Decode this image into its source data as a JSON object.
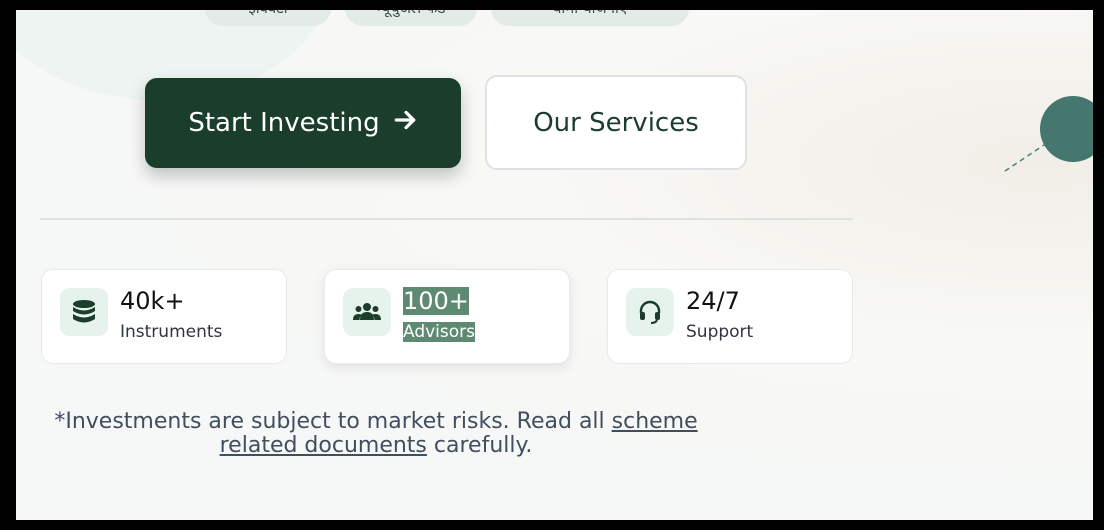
{
  "hero": {
    "tags": [
      "इक्विटी",
      "म्यूचुअल फंड",
      "बीमा योजनाएं"
    ],
    "primary_cta": "Start Investing",
    "secondary_cta": "Our Services"
  },
  "stats": [
    {
      "value": "40k+",
      "label": "Instruments",
      "icon": "database-icon"
    },
    {
      "value": "100+",
      "label": "Advisors",
      "icon": "users-icon"
    },
    {
      "value": "24/7",
      "label": "Support",
      "icon": "headset-icon"
    }
  ],
  "disclaimer": {
    "prefix": "*Investments are subject to market risks. Read all ",
    "link": "scheme related documents",
    "suffix": " carefully."
  },
  "colors": {
    "primary": "#1b3d2c",
    "accent_circle": "#45776f",
    "highlight": "#5e8a72"
  }
}
